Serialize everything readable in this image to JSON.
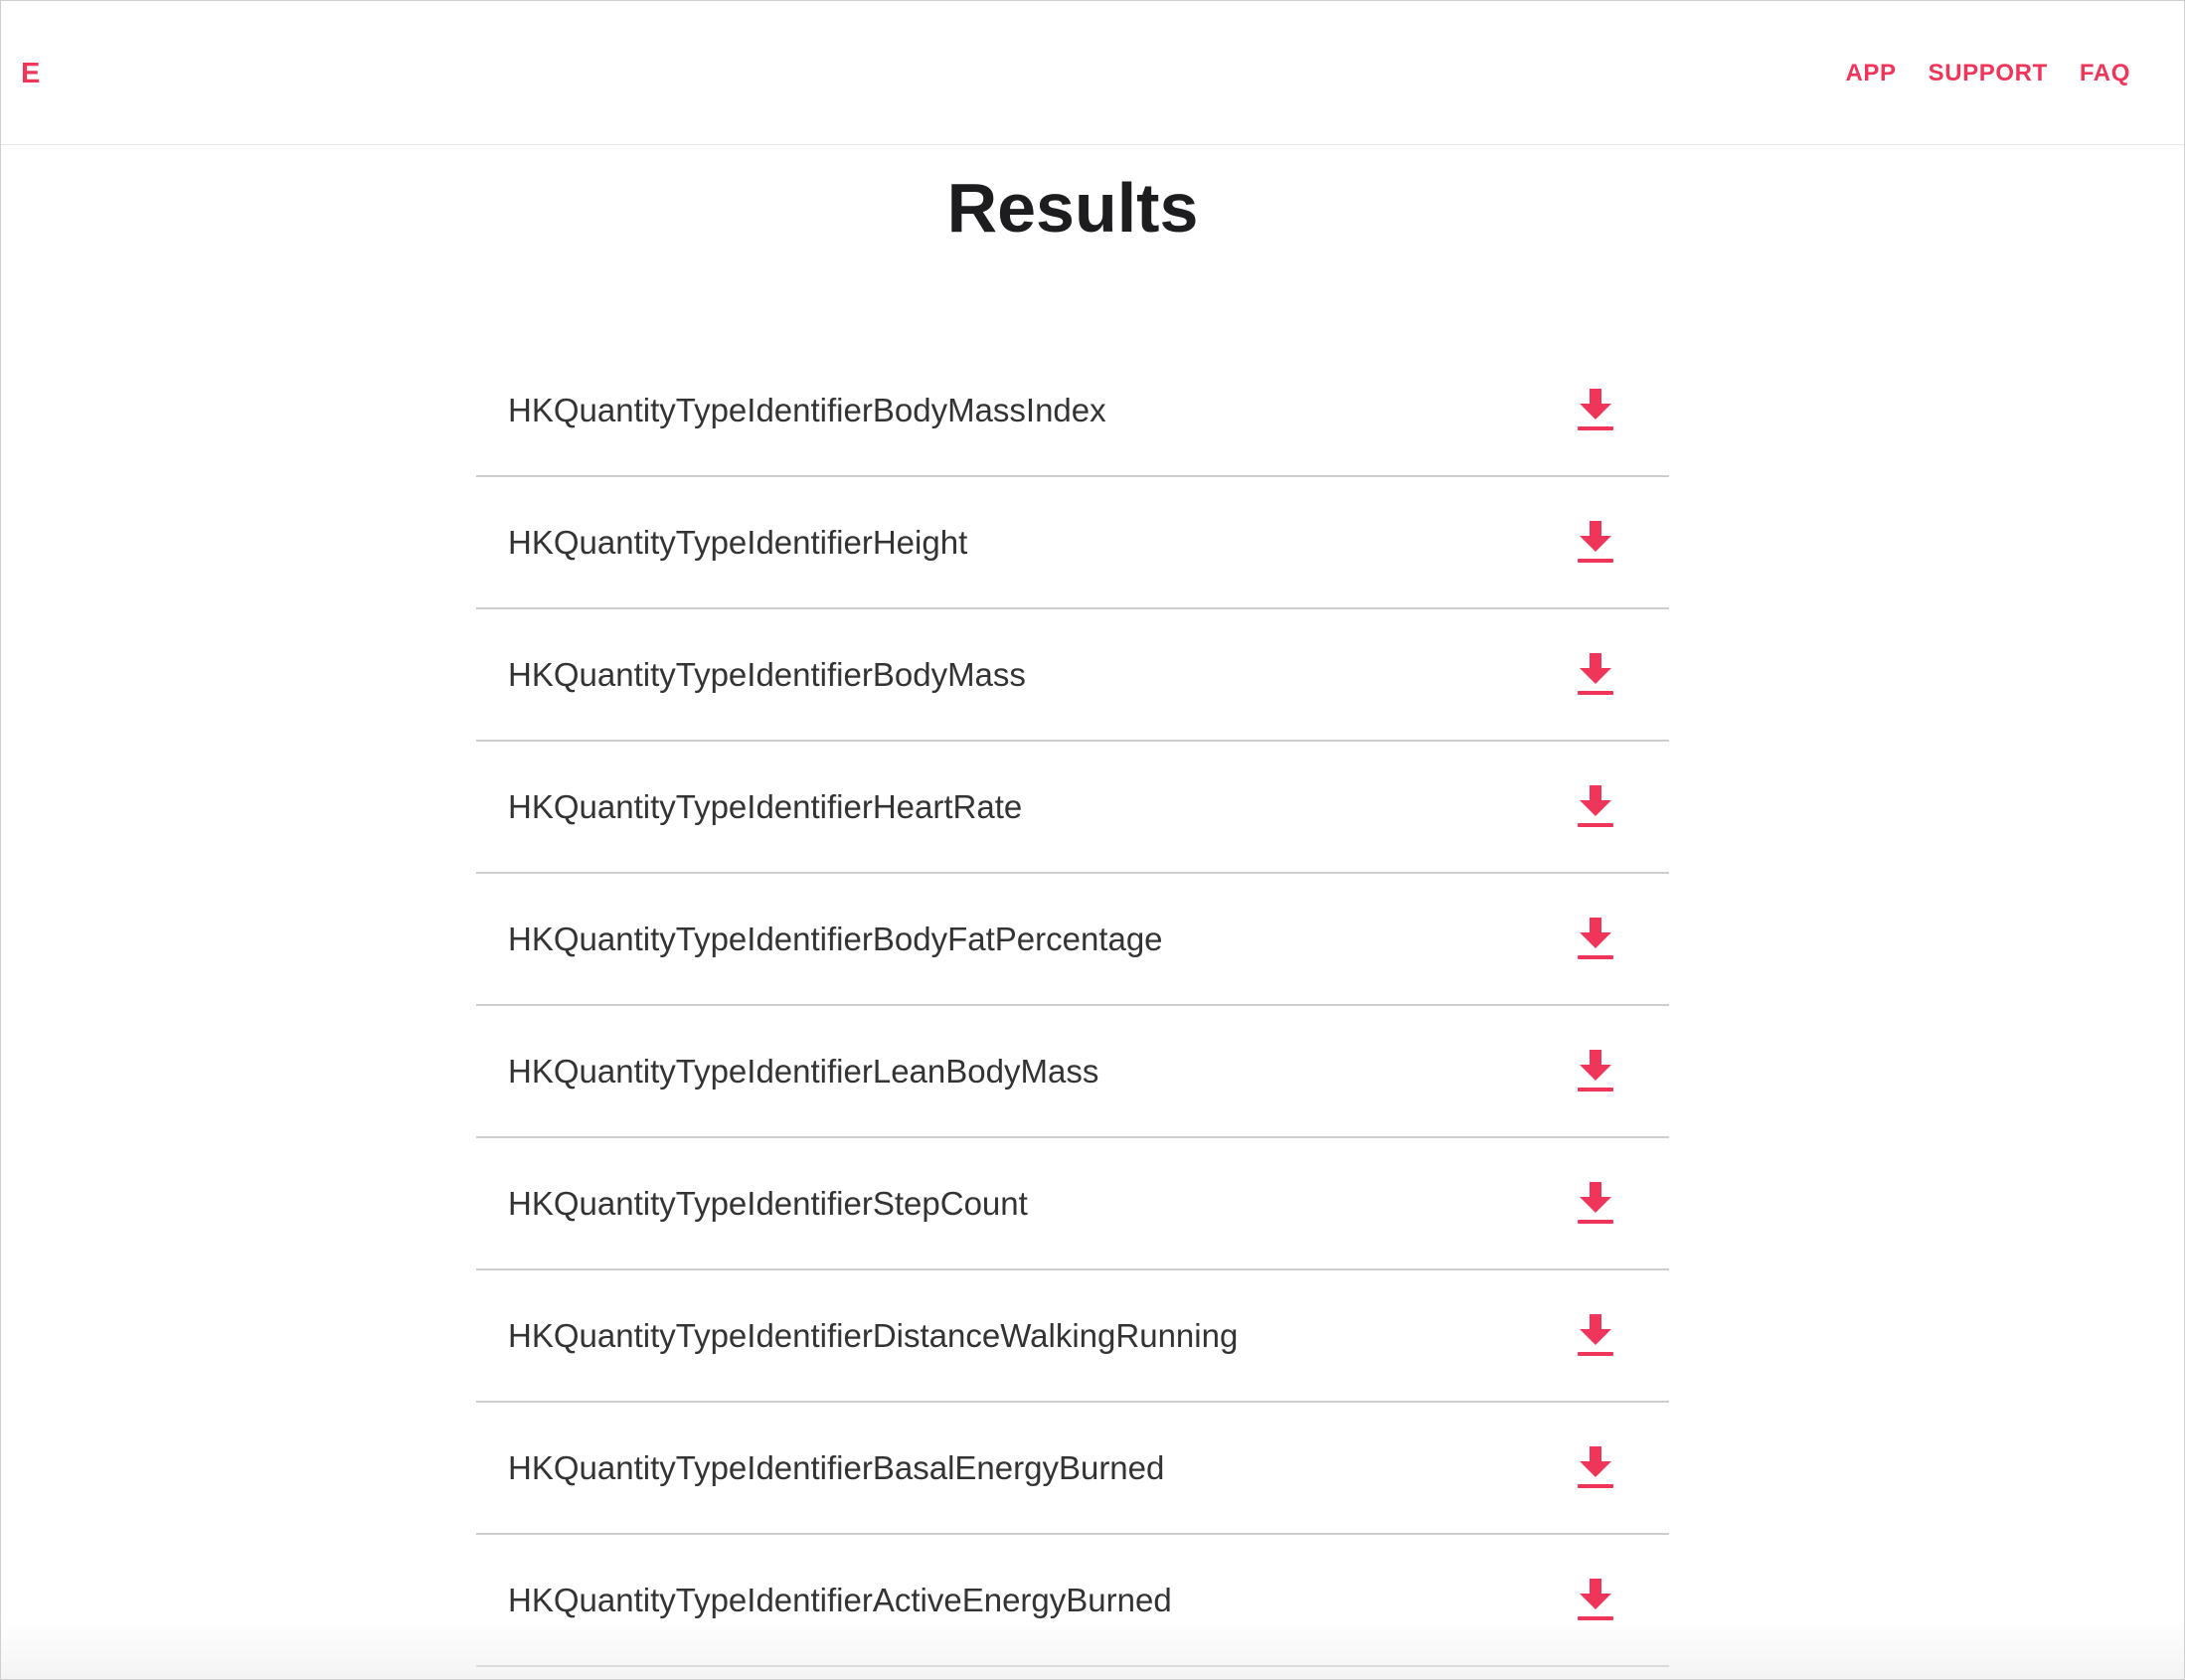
{
  "header": {
    "brand": "E",
    "nav": [
      "APP",
      "SUPPORT",
      "FAQ"
    ]
  },
  "main": {
    "title": "Results",
    "results": [
      {
        "name": "HKQuantityTypeIdentifierBodyMassIndex",
        "icon": "download-icon"
      },
      {
        "name": "HKQuantityTypeIdentifierHeight",
        "icon": "download-icon"
      },
      {
        "name": "HKQuantityTypeIdentifierBodyMass",
        "icon": "download-icon"
      },
      {
        "name": "HKQuantityTypeIdentifierHeartRate",
        "icon": "download-icon"
      },
      {
        "name": "HKQuantityTypeIdentifierBodyFatPercentage",
        "icon": "download-icon"
      },
      {
        "name": "HKQuantityTypeIdentifierLeanBodyMass",
        "icon": "download-icon"
      },
      {
        "name": "HKQuantityTypeIdentifierStepCount",
        "icon": "download-icon"
      },
      {
        "name": "HKQuantityTypeIdentifierDistanceWalkingRunning",
        "icon": "download-icon"
      },
      {
        "name": "HKQuantityTypeIdentifierBasalEnergyBurned",
        "icon": "download-icon"
      },
      {
        "name": "HKQuantityTypeIdentifierActiveEnergyBurned",
        "icon": "download-icon"
      }
    ]
  },
  "colors": {
    "accent": "#f0355a",
    "text": "#333333",
    "title": "#1d1d1f",
    "divider": "#cdcdcd"
  }
}
